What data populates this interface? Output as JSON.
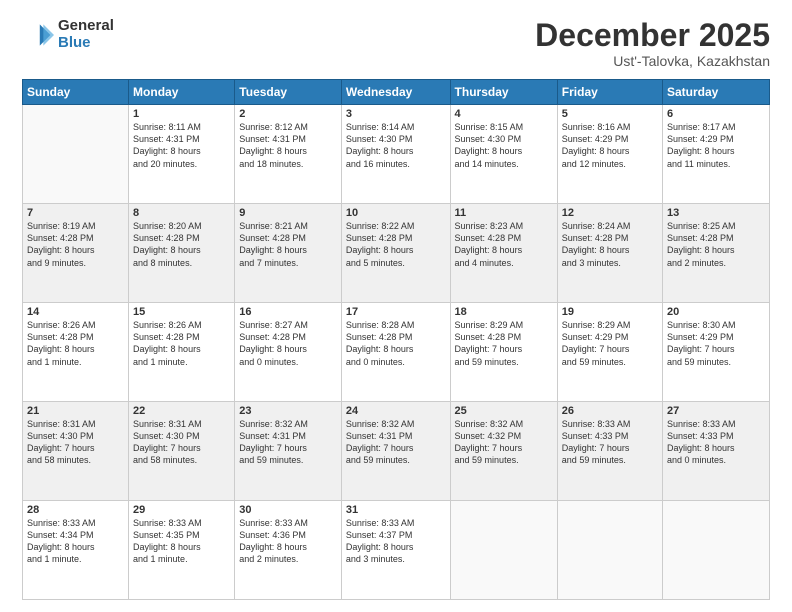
{
  "logo": {
    "general": "General",
    "blue": "Blue"
  },
  "header": {
    "title": "December 2025",
    "subtitle": "Ust'-Talovka, Kazakhstan"
  },
  "weekdays": [
    "Sunday",
    "Monday",
    "Tuesday",
    "Wednesday",
    "Thursday",
    "Friday",
    "Saturday"
  ],
  "weeks": [
    [
      {
        "day": "",
        "info": ""
      },
      {
        "day": "1",
        "info": "Sunrise: 8:11 AM\nSunset: 4:31 PM\nDaylight: 8 hours\nand 20 minutes."
      },
      {
        "day": "2",
        "info": "Sunrise: 8:12 AM\nSunset: 4:31 PM\nDaylight: 8 hours\nand 18 minutes."
      },
      {
        "day": "3",
        "info": "Sunrise: 8:14 AM\nSunset: 4:30 PM\nDaylight: 8 hours\nand 16 minutes."
      },
      {
        "day": "4",
        "info": "Sunrise: 8:15 AM\nSunset: 4:30 PM\nDaylight: 8 hours\nand 14 minutes."
      },
      {
        "day": "5",
        "info": "Sunrise: 8:16 AM\nSunset: 4:29 PM\nDaylight: 8 hours\nand 12 minutes."
      },
      {
        "day": "6",
        "info": "Sunrise: 8:17 AM\nSunset: 4:29 PM\nDaylight: 8 hours\nand 11 minutes."
      }
    ],
    [
      {
        "day": "7",
        "info": "Sunrise: 8:19 AM\nSunset: 4:28 PM\nDaylight: 8 hours\nand 9 minutes."
      },
      {
        "day": "8",
        "info": "Sunrise: 8:20 AM\nSunset: 4:28 PM\nDaylight: 8 hours\nand 8 minutes."
      },
      {
        "day": "9",
        "info": "Sunrise: 8:21 AM\nSunset: 4:28 PM\nDaylight: 8 hours\nand 7 minutes."
      },
      {
        "day": "10",
        "info": "Sunrise: 8:22 AM\nSunset: 4:28 PM\nDaylight: 8 hours\nand 5 minutes."
      },
      {
        "day": "11",
        "info": "Sunrise: 8:23 AM\nSunset: 4:28 PM\nDaylight: 8 hours\nand 4 minutes."
      },
      {
        "day": "12",
        "info": "Sunrise: 8:24 AM\nSunset: 4:28 PM\nDaylight: 8 hours\nand 3 minutes."
      },
      {
        "day": "13",
        "info": "Sunrise: 8:25 AM\nSunset: 4:28 PM\nDaylight: 8 hours\nand 2 minutes."
      }
    ],
    [
      {
        "day": "14",
        "info": "Sunrise: 8:26 AM\nSunset: 4:28 PM\nDaylight: 8 hours\nand 1 minute."
      },
      {
        "day": "15",
        "info": "Sunrise: 8:26 AM\nSunset: 4:28 PM\nDaylight: 8 hours\nand 1 minute."
      },
      {
        "day": "16",
        "info": "Sunrise: 8:27 AM\nSunset: 4:28 PM\nDaylight: 8 hours\nand 0 minutes."
      },
      {
        "day": "17",
        "info": "Sunrise: 8:28 AM\nSunset: 4:28 PM\nDaylight: 8 hours\nand 0 minutes."
      },
      {
        "day": "18",
        "info": "Sunrise: 8:29 AM\nSunset: 4:28 PM\nDaylight: 7 hours\nand 59 minutes."
      },
      {
        "day": "19",
        "info": "Sunrise: 8:29 AM\nSunset: 4:29 PM\nDaylight: 7 hours\nand 59 minutes."
      },
      {
        "day": "20",
        "info": "Sunrise: 8:30 AM\nSunset: 4:29 PM\nDaylight: 7 hours\nand 59 minutes."
      }
    ],
    [
      {
        "day": "21",
        "info": "Sunrise: 8:31 AM\nSunset: 4:30 PM\nDaylight: 7 hours\nand 58 minutes."
      },
      {
        "day": "22",
        "info": "Sunrise: 8:31 AM\nSunset: 4:30 PM\nDaylight: 7 hours\nand 58 minutes."
      },
      {
        "day": "23",
        "info": "Sunrise: 8:32 AM\nSunset: 4:31 PM\nDaylight: 7 hours\nand 59 minutes."
      },
      {
        "day": "24",
        "info": "Sunrise: 8:32 AM\nSunset: 4:31 PM\nDaylight: 7 hours\nand 59 minutes."
      },
      {
        "day": "25",
        "info": "Sunrise: 8:32 AM\nSunset: 4:32 PM\nDaylight: 7 hours\nand 59 minutes."
      },
      {
        "day": "26",
        "info": "Sunrise: 8:33 AM\nSunset: 4:33 PM\nDaylight: 7 hours\nand 59 minutes."
      },
      {
        "day": "27",
        "info": "Sunrise: 8:33 AM\nSunset: 4:33 PM\nDaylight: 8 hours\nand 0 minutes."
      }
    ],
    [
      {
        "day": "28",
        "info": "Sunrise: 8:33 AM\nSunset: 4:34 PM\nDaylight: 8 hours\nand 1 minute."
      },
      {
        "day": "29",
        "info": "Sunrise: 8:33 AM\nSunset: 4:35 PM\nDaylight: 8 hours\nand 1 minute."
      },
      {
        "day": "30",
        "info": "Sunrise: 8:33 AM\nSunset: 4:36 PM\nDaylight: 8 hours\nand 2 minutes."
      },
      {
        "day": "31",
        "info": "Sunrise: 8:33 AM\nSunset: 4:37 PM\nDaylight: 8 hours\nand 3 minutes."
      },
      {
        "day": "",
        "info": ""
      },
      {
        "day": "",
        "info": ""
      },
      {
        "day": "",
        "info": ""
      }
    ]
  ]
}
